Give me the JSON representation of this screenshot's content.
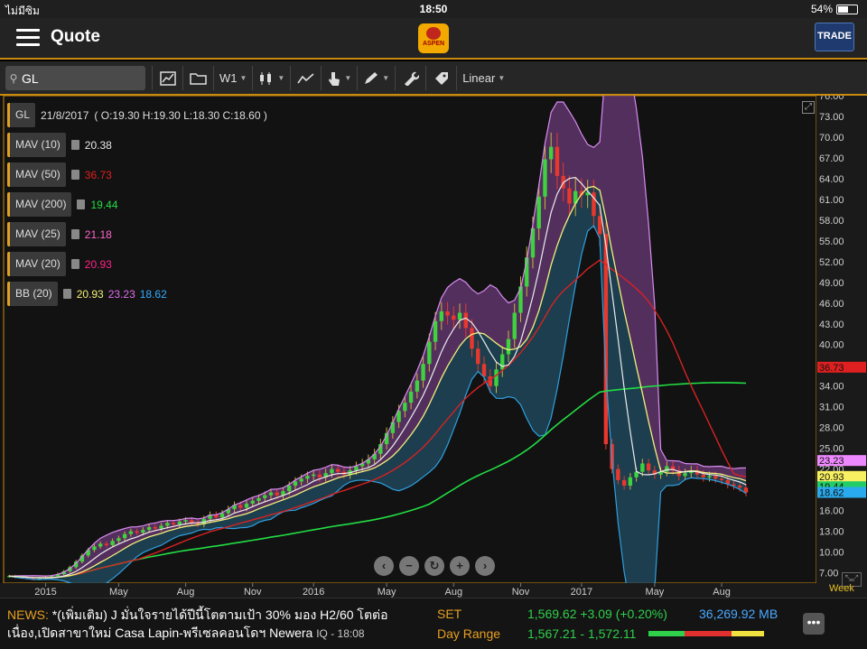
{
  "status": {
    "carrier": "ไม่มีซิม",
    "time": "18:50",
    "battery": "54%",
    "battery_fraction": 0.54
  },
  "nav": {
    "title": "Quote",
    "logo_text": "ASPEN",
    "trade_label": "TRADE"
  },
  "toolbar": {
    "symbol": "GL",
    "period": "W1",
    "scale": "Linear"
  },
  "legend": {
    "symbol": "GL",
    "date": "21/8/2017",
    "ohlc": "( O:19.30 H:19.30 L:18.30 C:18.60 )",
    "indicators": [
      {
        "name": "MAV (10)",
        "values": [
          "20.38"
        ],
        "colors": [
          "#e8e8e8"
        ]
      },
      {
        "name": "MAV (50)",
        "values": [
          "36.73"
        ],
        "colors": [
          "#e02020"
        ]
      },
      {
        "name": "MAV (200)",
        "values": [
          "19.44"
        ],
        "colors": [
          "#22dd44"
        ]
      },
      {
        "name": "MAV (25)",
        "values": [
          "21.18"
        ],
        "colors": [
          "#ff66cc"
        ]
      },
      {
        "name": "MAV (20)",
        "values": [
          "20.93"
        ],
        "colors": [
          "#ff2288"
        ]
      },
      {
        "name": "BB (20)",
        "values": [
          "20.93",
          "23.23",
          "18.62"
        ],
        "colors": [
          "#f4f07a",
          "#e06ef0",
          "#33aaff"
        ]
      }
    ]
  },
  "chart_data": {
    "type": "line",
    "y_ticks": [
      "76.00",
      "73.00",
      "70.00",
      "67.00",
      "64.00",
      "61.00",
      "58.00",
      "55.00",
      "52.00",
      "49.00",
      "46.00",
      "43.00",
      "40.00",
      "37.00",
      "34.00",
      "31.00",
      "28.00",
      "25.00",
      "22.00",
      "19.00",
      "16.00",
      "13.00",
      "10.00",
      "7.00"
    ],
    "y_range": [
      5.5,
      76
    ],
    "x_ticks": [
      "2015",
      "May",
      "Aug",
      "Nov",
      "2016",
      "May",
      "Aug",
      "Nov",
      "2017",
      "May",
      "Aug"
    ],
    "price_tags": [
      {
        "value": "36.73",
        "y": 36.73,
        "color": "#e02020",
        "text_color": "#111"
      },
      {
        "value": "23.23",
        "y": 23.23,
        "color": "#ee88ff",
        "text_color": "#111"
      },
      {
        "value": "20.93",
        "y": 20.93,
        "color": "#f8f060",
        "text_color": "#111"
      },
      {
        "value": "19.44",
        "y": 19.44,
        "color": "#22cc66",
        "text_color": "#111"
      },
      {
        "value": "18.62",
        "y": 18.62,
        "color": "#2aaaee",
        "text_color": "#111"
      }
    ],
    "close": [
      6.5,
      6.4,
      6.3,
      6.2,
      6.1,
      6.2,
      6.3,
      6.5,
      6.8,
      7.2,
      7.8,
      8.6,
      9.5,
      10.3,
      10.8,
      11.2,
      11.0,
      11.6,
      12.0,
      12.6,
      13.0,
      12.8,
      13.2,
      13.6,
      13.4,
      13.8,
      14.2,
      14.0,
      14.4,
      14.6,
      14.2,
      14.0,
      14.8,
      15.4,
      15.0,
      15.6,
      16.2,
      16.8,
      16.4,
      17.0,
      17.4,
      17.8,
      18.2,
      18.6,
      18.2,
      18.8,
      19.6,
      20.2,
      20.6,
      21.0,
      21.2,
      20.8,
      21.4,
      22.0,
      21.6,
      21.2,
      21.8,
      22.4,
      22.8,
      23.4,
      24.2,
      25.6,
      27.2,
      28.8,
      30.4,
      31.6,
      33.2,
      34.8,
      37.2,
      40.4,
      43.4,
      44.8,
      44.2,
      43.6,
      44.6,
      42.4,
      39.4,
      37.2,
      35.4,
      34.0,
      36.4,
      38.6,
      40.8,
      44.6,
      48.4,
      52.6,
      56.8,
      61.4,
      66.8,
      68.6,
      64.4,
      62.6,
      60.4,
      62.2,
      61.6,
      62.0,
      58.6,
      56.0,
      25.6,
      22.0,
      20.4,
      19.6,
      20.8,
      21.6,
      22.8,
      21.8,
      21.2,
      21.6,
      22.4,
      21.8,
      21.0,
      21.4,
      21.8,
      21.2,
      20.8,
      21.0,
      20.6,
      20.4,
      19.8,
      19.6,
      19.3,
      18.6
    ],
    "series": [
      {
        "name": "MAV (10)",
        "color": "#e8e8e8"
      },
      {
        "name": "MAV (20)",
        "color": "#f4f07a"
      },
      {
        "name": "MAV (50)",
        "color": "#e02020"
      },
      {
        "name": "MAV (200)",
        "color": "#22dd44"
      },
      {
        "name": "BB (20) upper",
        "color": "#e06ef0"
      },
      {
        "name": "BB (20) lower",
        "color": "#33aaff"
      }
    ],
    "grid": false
  },
  "chart_ui": {
    "period_label": "Week"
  },
  "footer": {
    "news_tag": "NEWS:",
    "news_text": "*(เพิ่มเติม) J มั่นใจรายได้ปีนี้โตตามเป้า 30% มอง H2/60 โตต่อเนื่อง,เปิดสาขาใหม่ Casa Lapin-พรีเซลคอนโดฯ Newera",
    "news_source": "IQ - 18:08",
    "set_label": "SET",
    "set_value": "1,569.62 +3.09 (+0.20%)",
    "set_volume": "36,269.92 MB",
    "range_label": "Day Range",
    "range_low": "1,567.21",
    "range_sep": "-",
    "range_high": "1,572.11",
    "more_label": "•••"
  }
}
